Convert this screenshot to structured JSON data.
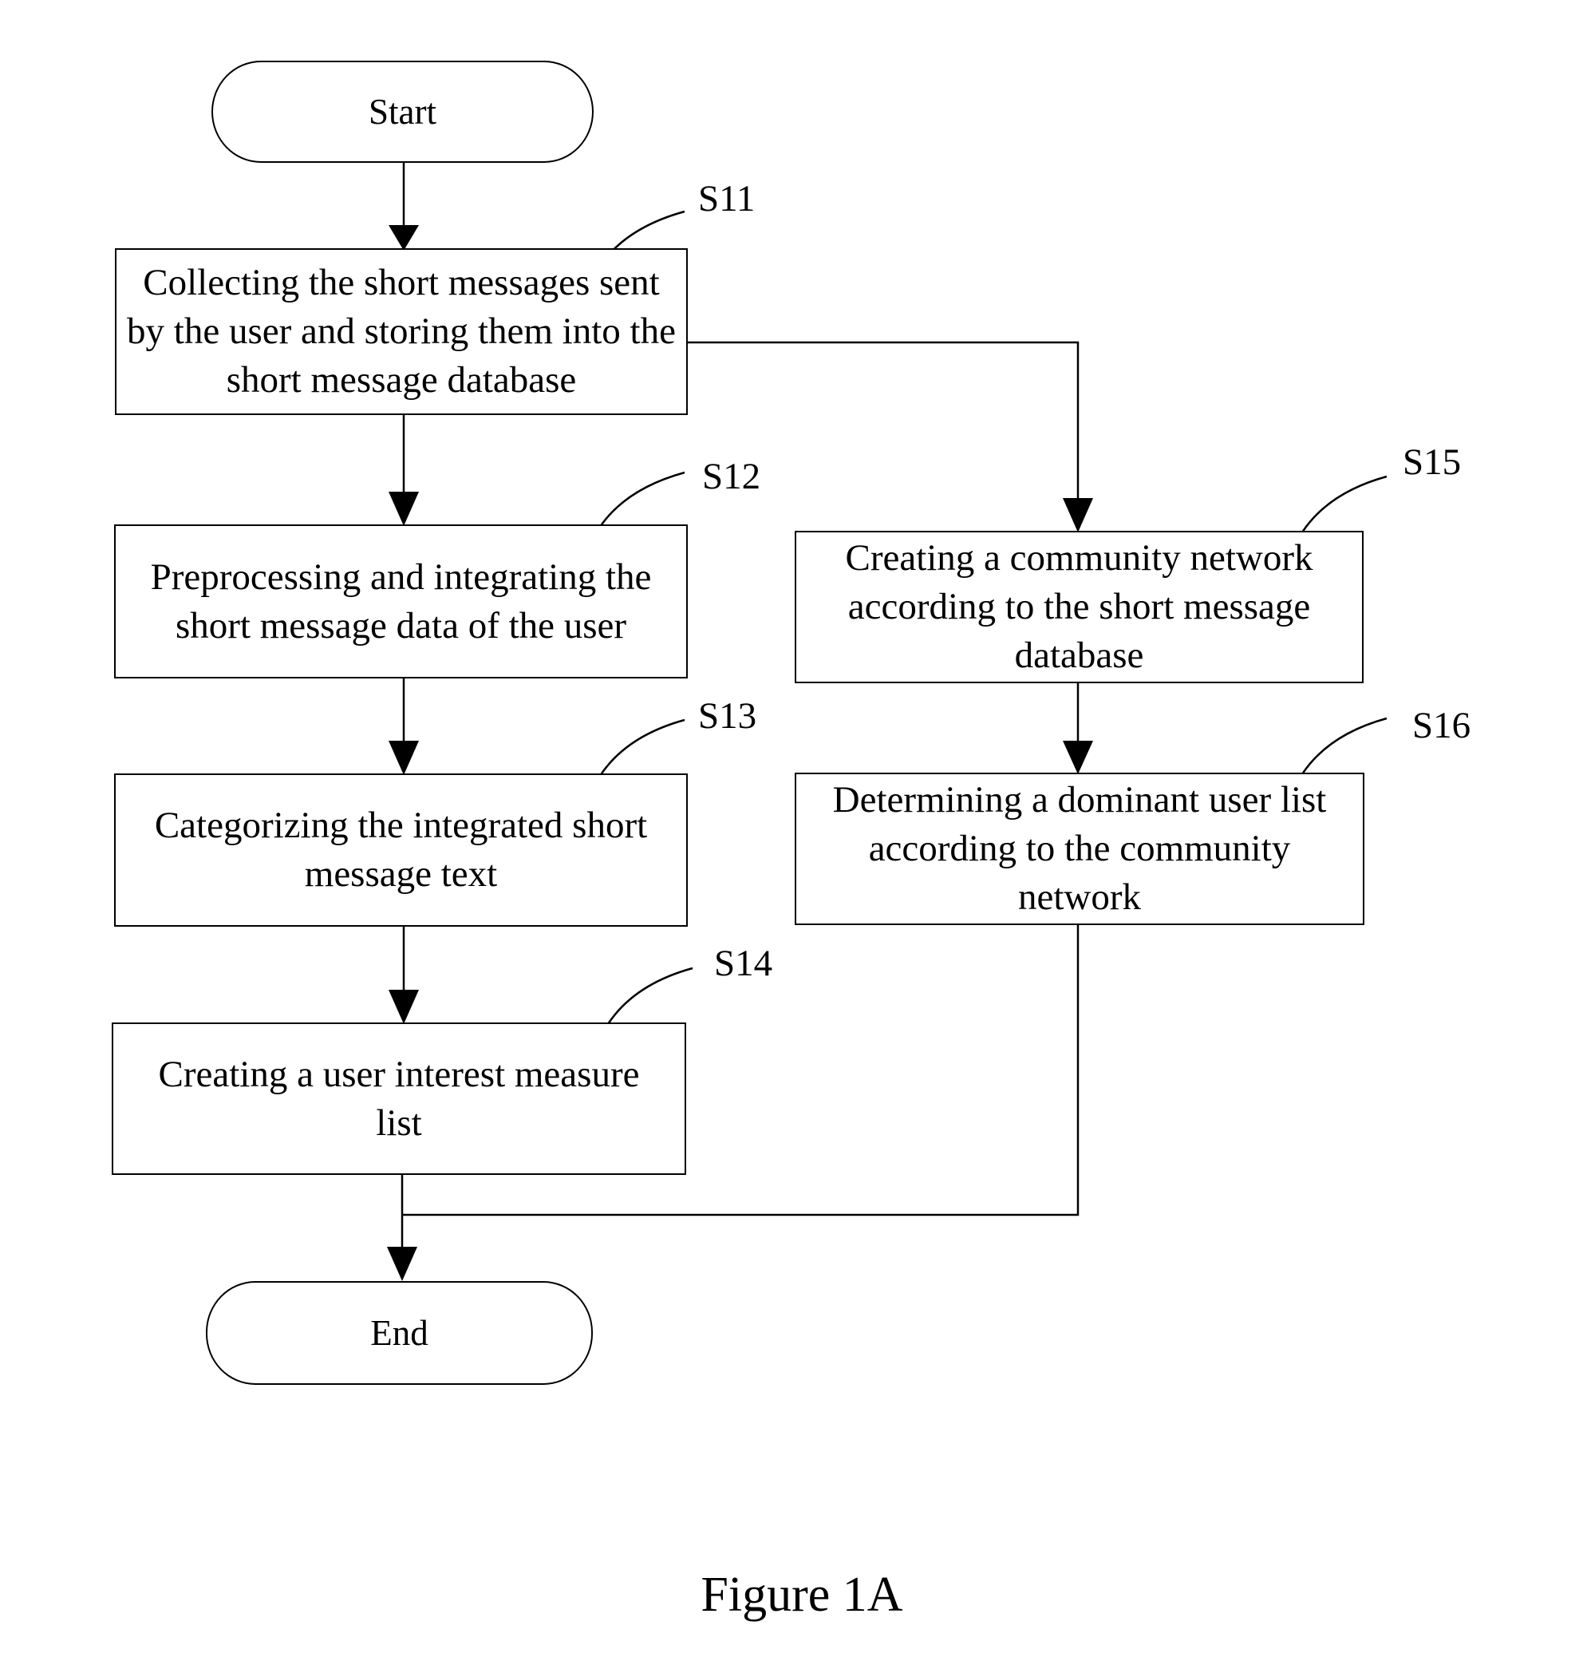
{
  "diagram": {
    "type": "flowchart",
    "nodes": {
      "start": {
        "label": "Start"
      },
      "s11": {
        "step": "S11",
        "text": "Collecting the short messages sent by the user and storing them into the short message database"
      },
      "s12": {
        "step": "S12",
        "text": "Preprocessing and integrating the short message data of the user"
      },
      "s13": {
        "step": "S13",
        "text": "Categorizing the integrated short message text"
      },
      "s14": {
        "step": "S14",
        "text": "Creating a user interest measure list"
      },
      "s15": {
        "step": "S15",
        "text": "Creating a community network according to the short message database"
      },
      "s16": {
        "step": "S16",
        "text": "Determining a dominant user list according to the community network"
      },
      "end": {
        "label": "End"
      }
    },
    "edges": [
      [
        "start",
        "s11"
      ],
      [
        "s11",
        "s12"
      ],
      [
        "s12",
        "s13"
      ],
      [
        "s13",
        "s14"
      ],
      [
        "s14",
        "end"
      ],
      [
        "s11",
        "s15"
      ],
      [
        "s15",
        "s16"
      ],
      [
        "s16",
        "end"
      ]
    ],
    "caption": "Figure 1A"
  }
}
